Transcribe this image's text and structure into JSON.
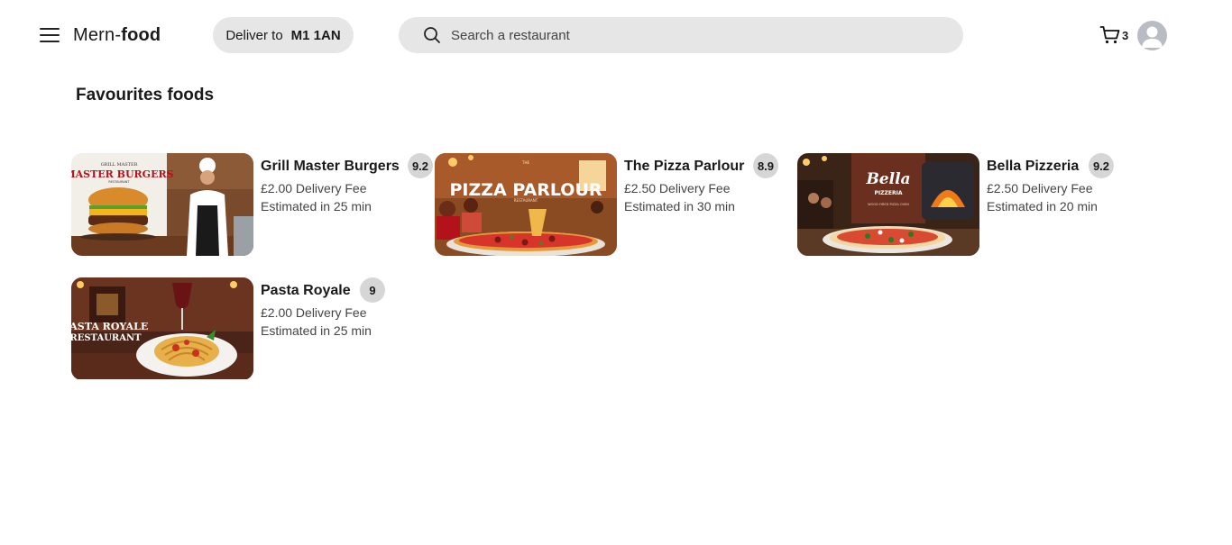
{
  "header": {
    "brand_prefix": "Mern-",
    "brand_suffix": "food",
    "deliver_label": "Deliver to",
    "deliver_postcode": "M1 1AN",
    "search_placeholder": "Search a restaurant",
    "cart_count": "3"
  },
  "main": {
    "section_title": "Favourites foods",
    "restaurants": [
      {
        "name": "Grill Master Burgers",
        "rating": "9.2",
        "fee": "£2.00 Delivery Fee",
        "eta": "Estimated in 25 min",
        "image_text": "GRILL MASTER / MASTER BURGERS / RESTAURANT"
      },
      {
        "name": "The Pizza Parlour",
        "rating": "8.9",
        "fee": "£2.50 Delivery Fee",
        "eta": "Estimated in 30 min",
        "image_text": "THE PIZZA PARLOUR RESTAURANT"
      },
      {
        "name": "Bella Pizzeria",
        "rating": "9.2",
        "fee": "£2.50 Delivery Fee",
        "eta": "Estimated in 20 min",
        "image_text": "Bella PIZZERIA"
      },
      {
        "name": "Pasta Royale",
        "rating": "9",
        "fee": "£2.00 Delivery Fee",
        "eta": "Estimated in 25 min",
        "image_text": "PASTA ROYALE RESTAURANT"
      }
    ]
  },
  "colors": {
    "pill_background": "#e6e6e6",
    "rating_badge": "#d6d6d6",
    "avatar": "#b9bcc4"
  },
  "icons": [
    "menu-icon",
    "search-icon",
    "cart-icon",
    "user-avatar-icon"
  ]
}
